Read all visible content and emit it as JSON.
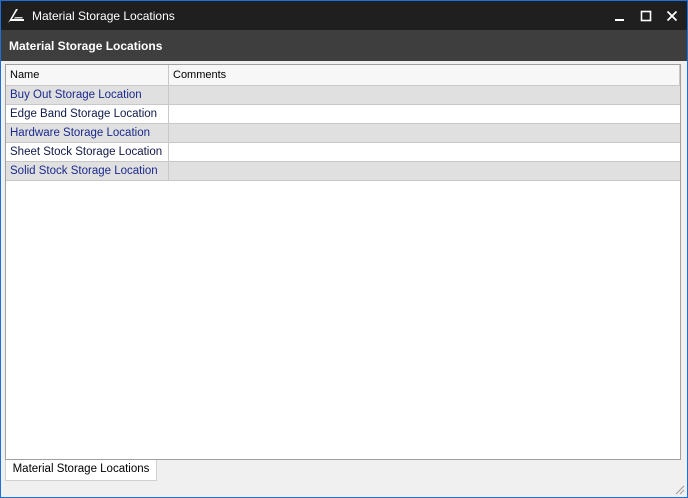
{
  "window": {
    "title": "Material Storage Locations",
    "logo_icon": "app-logo-icon",
    "controls": {
      "minimize_icon": "minimize-icon",
      "maximize_icon": "maximize-icon",
      "close_icon": "close-icon"
    },
    "colors": {
      "titlebar": "#1f1f1f",
      "header": "#3e3e3e",
      "accent_border": "#1e6fd9"
    }
  },
  "header": {
    "title": "Material Storage Locations"
  },
  "grid": {
    "columns": [
      "Name",
      "Comments"
    ],
    "rows": [
      {
        "name": "Buy Out Storage Location",
        "comments": ""
      },
      {
        "name": "Edge Band Storage Location",
        "comments": ""
      },
      {
        "name": "Hardware Storage Location",
        "comments": ""
      },
      {
        "name": "Sheet Stock Storage Location",
        "comments": ""
      },
      {
        "name": "Solid Stock Storage Location",
        "comments": ""
      }
    ]
  },
  "bottom_tabs": [
    {
      "label": "Material Storage Locations"
    }
  ]
}
